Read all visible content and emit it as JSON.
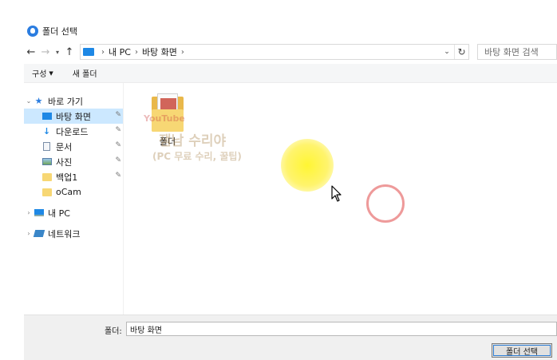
{
  "window": {
    "title": "폴더 선택"
  },
  "nav": {
    "back_icon": "arrow-left-icon",
    "forward_icon": "arrow-right-icon",
    "recent_icon": "chevron-down-icon",
    "up_icon": "arrow-up-icon",
    "breadcrumbs": [
      "내 PC",
      "바탕 화면"
    ],
    "search_placeholder": "바탕 화면 검색"
  },
  "toolbar": {
    "organize_label": "구성",
    "new_folder_label": "새 폴더"
  },
  "sidebar": {
    "quick_access": "바로 가기",
    "items": [
      {
        "label": "바탕 화면",
        "icon": "desktop-icon"
      },
      {
        "label": "다운로드",
        "icon": "download-icon"
      },
      {
        "label": "문서",
        "icon": "document-icon"
      },
      {
        "label": "사진",
        "icon": "pictures-icon"
      },
      {
        "label": "백업1",
        "icon": "folder-icon"
      },
      {
        "label": "oCam",
        "icon": "folder-icon"
      }
    ],
    "this_pc": "내 PC",
    "network": "네트워크"
  },
  "content": {
    "folder_name": "폴더",
    "watermark_line1": "잼남 수리야",
    "watermark_line2": "(PC 무료 수리, 꿀팁)",
    "watermark_yt": "YouTube"
  },
  "footer": {
    "folder_label": "폴더:",
    "folder_value": "바탕 화면",
    "select_button": "폴더 선택"
  },
  "colors": {
    "selection": "#cce8ff",
    "accent": "#1e88e5",
    "folder": "#f7d774",
    "highlight": "#fff528"
  }
}
